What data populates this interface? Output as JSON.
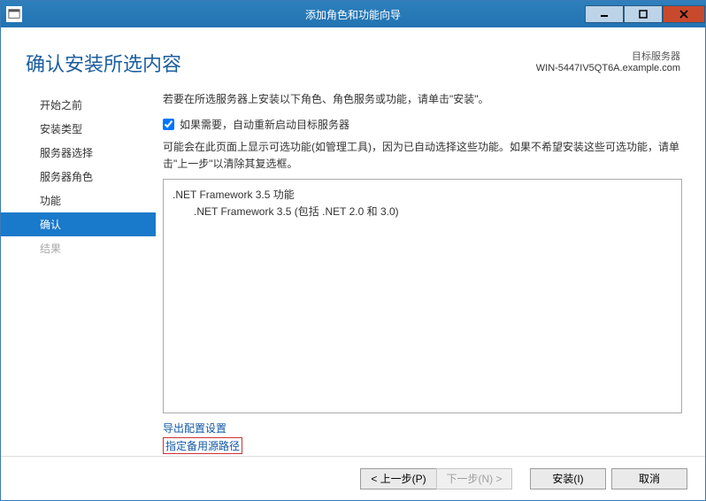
{
  "titlebar": {
    "title": "添加角色和功能向导"
  },
  "header": {
    "page_title": "确认安装所选内容",
    "target_label": "目标服务器",
    "target_server": "WIN-5447IV5QT6A.example.com"
  },
  "sidebar": {
    "items": [
      {
        "label": "开始之前",
        "state": "normal"
      },
      {
        "label": "安装类型",
        "state": "normal"
      },
      {
        "label": "服务器选择",
        "state": "normal"
      },
      {
        "label": "服务器角色",
        "state": "normal"
      },
      {
        "label": "功能",
        "state": "normal"
      },
      {
        "label": "确认",
        "state": "selected"
      },
      {
        "label": "结果",
        "state": "disabled"
      }
    ]
  },
  "content": {
    "description": "若要在所选服务器上安装以下角色、角色服务或功能，请单击\"安装\"。",
    "restart_checkbox_label": "如果需要，自动重新启动目标服务器",
    "restart_checked": true,
    "note": "可能会在此页面上显示可选功能(如管理工具)，因为已自动选择这些功能。如果不希望安装这些可选功能，请单击\"上一步\"以清除其复选框。",
    "features": [
      {
        "label": ".NET Framework 3.5 功能",
        "level": 0
      },
      {
        "label": ".NET Framework 3.5 (包括 .NET 2.0 和 3.0)",
        "level": 1
      }
    ],
    "export_link": "导出配置设置",
    "altpath_link": "指定备用源路径"
  },
  "footer": {
    "back": "< 上一步(P)",
    "next": "下一步(N) >",
    "install": "安装(I)",
    "cancel": "取消"
  }
}
